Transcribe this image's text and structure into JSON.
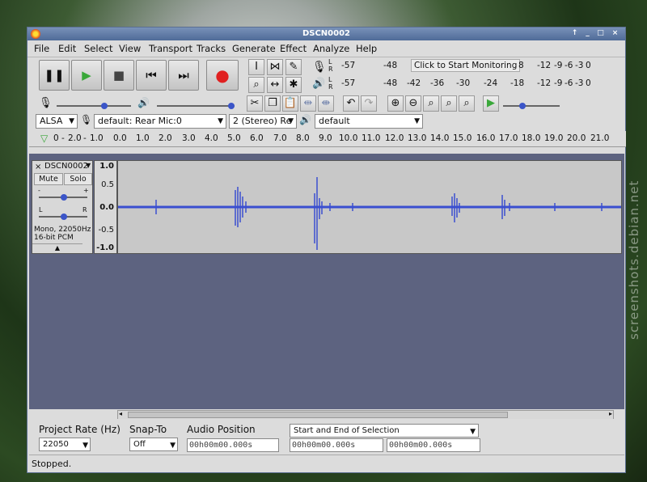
{
  "window": {
    "title": "DSCN0002"
  },
  "menu": [
    "File",
    "Edit",
    "Select",
    "View",
    "Transport",
    "Tracks",
    "Generate",
    "Effect",
    "Analyze",
    "Help"
  ],
  "meters": {
    "record_ticks": [
      "-57",
      "-48"
    ],
    "monitor_label": "Click to Start Monitoring",
    "record_ticks_right": [
      "8",
      "-12",
      "-9",
      "-6",
      "-3",
      "0"
    ],
    "playback_ticks": [
      "-57",
      "-48",
      "-42",
      "-36",
      "-30",
      "-24",
      "-18",
      "-12",
      "-9",
      "-6",
      "-3",
      "0"
    ],
    "lr": [
      "L",
      "R"
    ]
  },
  "devices": {
    "host": "ALSA",
    "input": "default: Rear Mic:0",
    "channels": "2 (Stereo) Re",
    "output": "default"
  },
  "ruler": {
    "ticks": [
      "0",
      "-",
      "2.0",
      "-",
      "1.0",
      "0.0",
      "1.0",
      "2.0",
      "3.0",
      "4.0",
      "5.0",
      "6.0",
      "7.0",
      "8.0",
      "9.0",
      "10.0",
      "11.0",
      "12.0",
      "13.0",
      "14.0",
      "15.0",
      "16.0",
      "17.0",
      "18.0",
      "19.0",
      "20.0",
      "21.0"
    ]
  },
  "track": {
    "name": "DSCN0002",
    "mute": "Mute",
    "solo": "Solo",
    "gain_left": "-",
    "gain_right": "+",
    "pan_left": "L",
    "pan_right": "R",
    "info1": "Mono, 22050Hz",
    "info2": "16-bit PCM",
    "scale": [
      "1.0",
      "0.5",
      "0.0",
      "-0.5",
      "-1.0"
    ]
  },
  "bottom": {
    "rate_label": "Project Rate (Hz)",
    "rate_value": "22050",
    "snap_label": "Snap-To",
    "snap_value": "Off",
    "pos_label": "Audio Position",
    "sel_label": "Start and End of Selection",
    "time1": "00h00m00.000s",
    "time2": "00h00m00.000s",
    "time3": "00h00m00.000s"
  },
  "status": "Stopped.",
  "watermark": "screenshots.debian.net",
  "colors": {
    "wave": "#3a4fd0",
    "track_bg": "#5d6380",
    "titlebar": "#5e79a6"
  }
}
